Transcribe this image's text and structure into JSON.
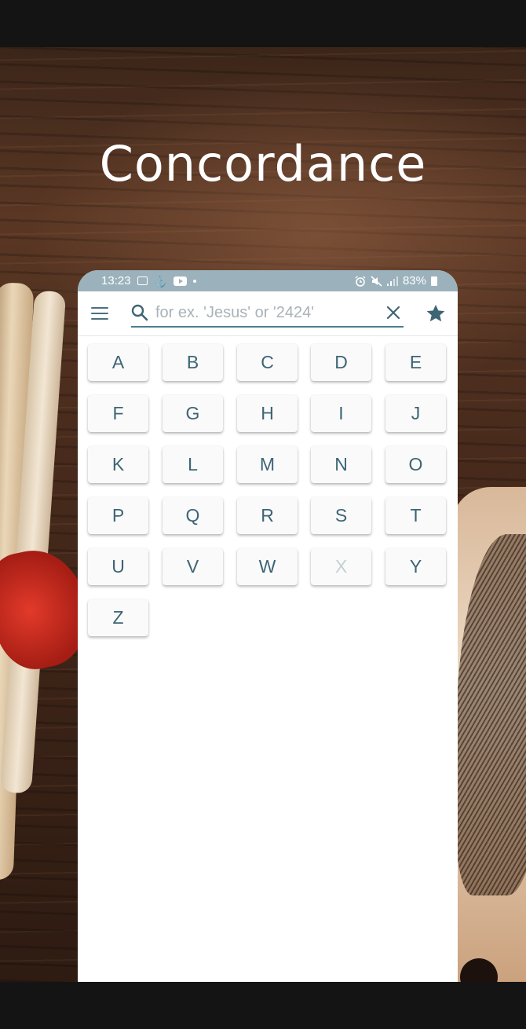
{
  "promo": {
    "headline": "Concordance"
  },
  "status_bar": {
    "time": "13:23",
    "battery": "83%",
    "left_icons": [
      "image-icon",
      "anchor-icon",
      "youtube-icon",
      "dot-icon"
    ],
    "right_icons": [
      "alarm-icon",
      "mute-icon",
      "signal-icon",
      "battery-icon"
    ],
    "background_color": "#9bb2bc"
  },
  "toolbar": {
    "menu_icon": "menu-icon",
    "search": {
      "placeholder": "for ex. 'Jesus' or '2424'",
      "value": ""
    },
    "clear_icon": "close-icon",
    "favorites_icon": "star-icon"
  },
  "letters": [
    {
      "label": "A",
      "enabled": true
    },
    {
      "label": "B",
      "enabled": true
    },
    {
      "label": "C",
      "enabled": true
    },
    {
      "label": "D",
      "enabled": true
    },
    {
      "label": "E",
      "enabled": true
    },
    {
      "label": "F",
      "enabled": true
    },
    {
      "label": "G",
      "enabled": true
    },
    {
      "label": "H",
      "enabled": true
    },
    {
      "label": "I",
      "enabled": true
    },
    {
      "label": "J",
      "enabled": true
    },
    {
      "label": "K",
      "enabled": true
    },
    {
      "label": "L",
      "enabled": true
    },
    {
      "label": "M",
      "enabled": true
    },
    {
      "label": "N",
      "enabled": true
    },
    {
      "label": "O",
      "enabled": true
    },
    {
      "label": "P",
      "enabled": true
    },
    {
      "label": "Q",
      "enabled": true
    },
    {
      "label": "R",
      "enabled": true
    },
    {
      "label": "S",
      "enabled": true
    },
    {
      "label": "T",
      "enabled": true
    },
    {
      "label": "U",
      "enabled": true
    },
    {
      "label": "V",
      "enabled": true
    },
    {
      "label": "W",
      "enabled": true
    },
    {
      "label": "X",
      "enabled": false
    },
    {
      "label": "Y",
      "enabled": true
    },
    {
      "label": "Z",
      "enabled": true
    }
  ],
  "colors": {
    "accent": "#3d6574",
    "disabled_letter": "#c3d1d6",
    "status_bar": "#9bb2bc"
  }
}
